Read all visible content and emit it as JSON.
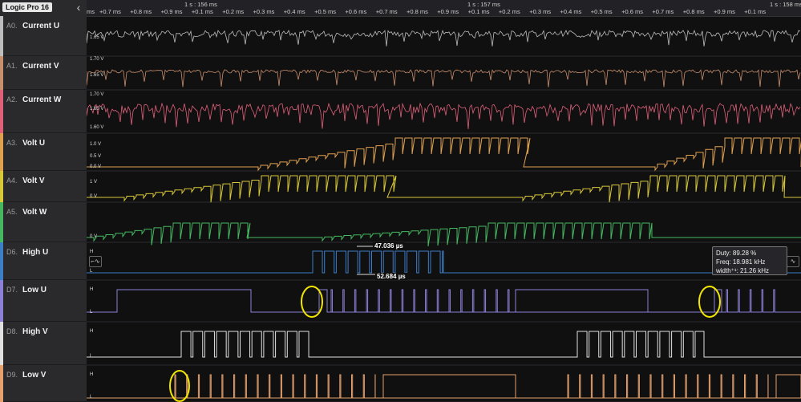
{
  "app": {
    "title": "Logic Pro 16",
    "collapse_glyph": "‹"
  },
  "channels": [
    {
      "id": "A0.",
      "name": "Current U",
      "color": "#bdbdbd"
    },
    {
      "id": "A1.",
      "name": "Current V",
      "color": "#c98f6c"
    },
    {
      "id": "A2.",
      "name": "Current W",
      "color": "#e0607a"
    },
    {
      "id": "A3.",
      "name": "Volt U",
      "color": "#e0a14f"
    },
    {
      "id": "A4.",
      "name": "Volt  V",
      "color": "#d8c838"
    },
    {
      "id": "A5.",
      "name": "Volt W",
      "color": "#44b860"
    },
    {
      "id": "D6.",
      "name": "High U",
      "color": "#3d7ec8"
    },
    {
      "id": "D7.",
      "name": "Low U",
      "color": "#8d80d9"
    },
    {
      "id": "D8.",
      "name": "High V",
      "color": "#e0e0e0"
    },
    {
      "id": "D9.",
      "name": "Low V",
      "color": "#e5a06c"
    }
  ],
  "time": {
    "major": [
      "1 s : 156 ms",
      "1 s : 157 ms",
      "1 s : 158 ms"
    ],
    "minor": [
      "+0.7 ms",
      "+0.8 ms",
      "+0.9 ms",
      "+0.1 ms",
      "+0.2 ms",
      "+0.3 ms",
      "+0.4 ms",
      "+0.5 ms",
      "+0.6 ms",
      "+0.7 ms",
      "+0.8 ms",
      "+0.9 ms",
      "+0.1 ms",
      "+0.2 ms",
      "+0.3 ms",
      "+0.4 ms",
      "+0.5 ms",
      "+0.6 ms",
      "+0.7 ms",
      "+0.8 ms",
      "+0.9 ms",
      "+0.1 ms"
    ],
    "leading": "ms"
  },
  "volts": {
    "a0": "1.65 V",
    "a1_top": "1.70 V",
    "a1": "1.65 V",
    "a2_top": "1.70 V",
    "a2_mid": "1.65 V",
    "a2_bot": "1.60 V",
    "a3_top": "1.0 V",
    "a3_mid": "0.5 V",
    "a3_bot": "0.0 V",
    "a4_top": "1 V",
    "a4_bot": "0 V",
    "a5_bot": "0 V"
  },
  "logic": {
    "high": "H",
    "low": "L"
  },
  "measurements": {
    "period": "47.036 µs",
    "width": "52.684 µs"
  },
  "tooltip": {
    "duty": "Duty: 89.28 %",
    "freq": "Freq: 18.981 kHz",
    "width": "width⁺¹: 21.26 kHz"
  },
  "trigger_icons": {
    "left": "⌐∿",
    "right": "∿"
  }
}
